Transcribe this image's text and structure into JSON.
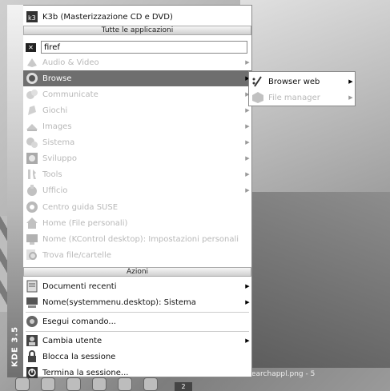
{
  "top_app": {
    "label": "K3b (Masterizzazione CD e DVD)",
    "icon": "k3b-icon"
  },
  "sections": {
    "all_apps": "Tutte le applicazioni",
    "actions": "Azioni"
  },
  "search": {
    "value": "firef",
    "clear_icon": "clear-icon"
  },
  "categories": [
    {
      "label": "Audio & Video",
      "icon": "multimedia-icon",
      "enabled": false,
      "submenu": true
    },
    {
      "label": "Browse",
      "icon": "browse-icon",
      "enabled": true,
      "submenu": true,
      "highlighted": true
    },
    {
      "label": "Communicate",
      "icon": "communicate-icon",
      "enabled": false,
      "submenu": true
    },
    {
      "label": "Giochi",
      "icon": "games-icon",
      "enabled": false,
      "submenu": true
    },
    {
      "label": "Images",
      "icon": "images-icon",
      "enabled": false,
      "submenu": true
    },
    {
      "label": "Sistema",
      "icon": "system-icon",
      "enabled": false,
      "submenu": true
    },
    {
      "label": "Sviluppo",
      "icon": "development-icon",
      "enabled": false,
      "submenu": true
    },
    {
      "label": "Tools",
      "icon": "tools-icon",
      "enabled": false,
      "submenu": true
    },
    {
      "label": "Ufficio",
      "icon": "office-icon",
      "enabled": false,
      "submenu": true
    },
    {
      "label": "Centro guida SUSE",
      "icon": "help-icon",
      "enabled": false,
      "submenu": false
    },
    {
      "label": "Home (File personali)",
      "icon": "home-icon",
      "enabled": false,
      "submenu": false
    },
    {
      "label": "Nome (KControl desktop): Impostazioni personali",
      "icon": "control-center-icon",
      "enabled": false,
      "submenu": false
    },
    {
      "label": "Trova file/cartelle",
      "icon": "find-icon",
      "enabled": false,
      "submenu": false
    }
  ],
  "actions": [
    {
      "label": "Documenti recenti",
      "icon": "documents-icon",
      "submenu": true
    },
    {
      "label": "Nome(systemmenu.desktop): Sistema",
      "icon": "computer-icon",
      "submenu": true
    },
    {
      "label": "Esegui comando...",
      "icon": "run-icon",
      "submenu": false
    },
    {
      "label": "Cambia utente",
      "icon": "user-icon",
      "submenu": true
    },
    {
      "label": "Blocca la sessione",
      "icon": "lock-icon",
      "submenu": false
    },
    {
      "label": "Termina la sessione...",
      "icon": "logout-icon",
      "submenu": false
    }
  ],
  "submenu": [
    {
      "label": "Browser web",
      "icon": "web-browser-icon",
      "enabled": true
    },
    {
      "label": "File manager",
      "icon": "file-manager-icon",
      "enabled": false
    }
  ],
  "sidebar": {
    "brand": "KDE 3.5"
  },
  "taskbar": {
    "window_text": "earchappl.png - 5",
    "desktop_number": "2"
  },
  "colors": {
    "highlight": "#6e6e6e",
    "disabled_text": "#b8b8b8"
  }
}
